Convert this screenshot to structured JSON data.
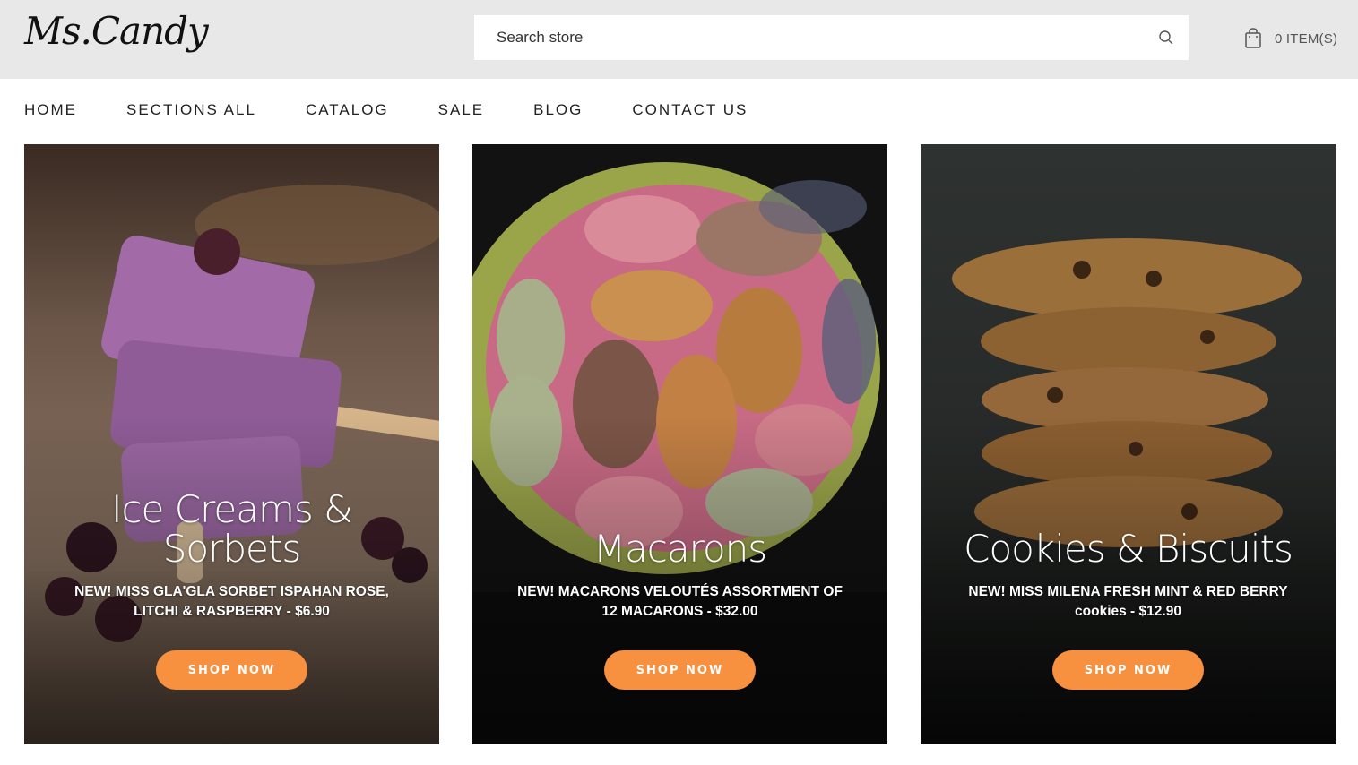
{
  "header": {
    "logo_text": "Ms.Candy",
    "search_placeholder": "Search store",
    "cart_label": "0 ITEM(S)"
  },
  "nav": {
    "items": [
      {
        "label": "HOME"
      },
      {
        "label": "SECTIONS ALL"
      },
      {
        "label": "CATALOG"
      },
      {
        "label": "SALE"
      },
      {
        "label": "BLOG"
      },
      {
        "label": "CONTACT US"
      }
    ]
  },
  "cards": [
    {
      "title": "Ice Creams & Sorbets",
      "description": "NEW! MISS GLA'GLA SORBET ISPAHAN ROSE, LITCHI & RASPBERRY - $6.90",
      "button_label": "SHOP NOW"
    },
    {
      "title": "Macarons",
      "description": "NEW! MACARONS VELOUTÉS ASSORTMENT OF 12 MACARONS - $32.00",
      "button_label": "SHOP NOW"
    },
    {
      "title": "Cookies & Biscuits",
      "description": "NEW! MISS MILENA FRESH MINT & RED BERRY cookies - $12.90",
      "button_label": "SHOP NOW"
    }
  ],
  "colors": {
    "header_bg": "#e8e8e8",
    "accent_button": "#f7913f"
  },
  "icons": [
    "search-icon",
    "shopping-bag-icon"
  ]
}
